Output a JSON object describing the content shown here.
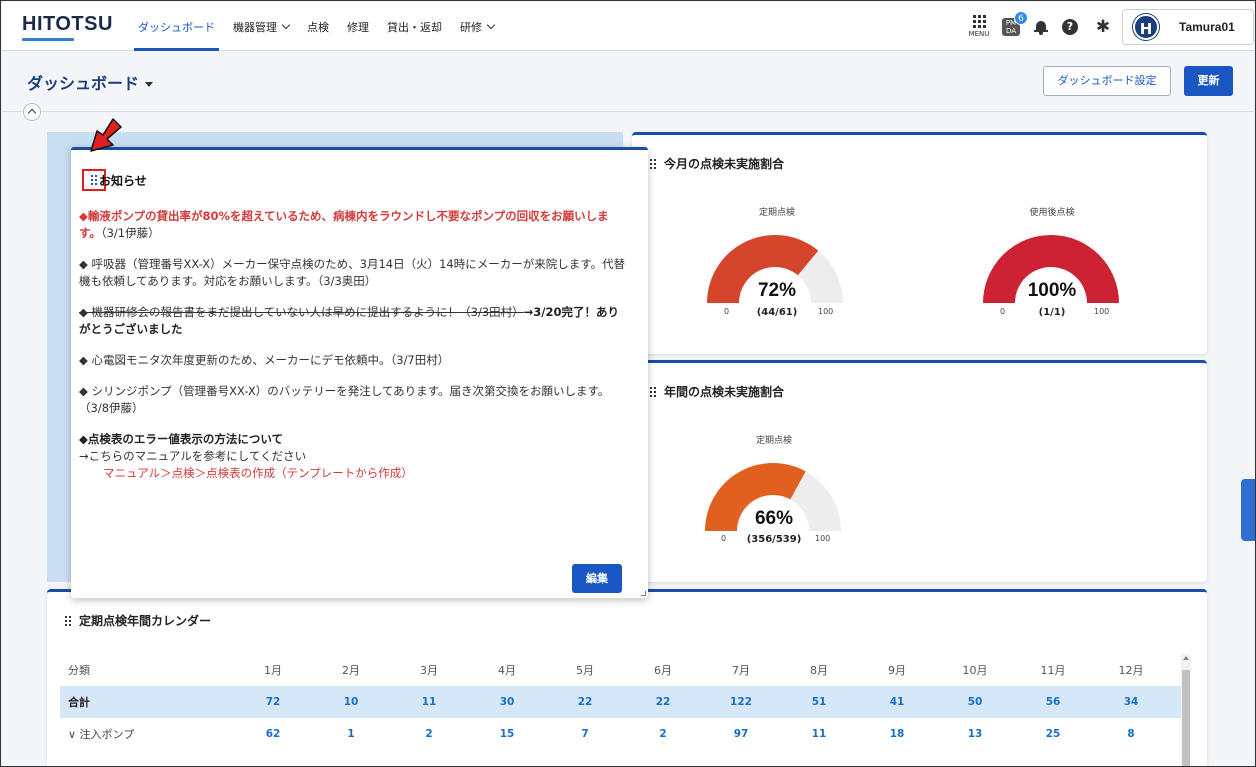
{
  "header": {
    "logo": "HITOTSU",
    "nav": [
      {
        "label": "ダッシュボード",
        "active": true,
        "dropdown": false
      },
      {
        "label": "機器管理",
        "active": false,
        "dropdown": true
      },
      {
        "label": "点検",
        "active": false,
        "dropdown": false
      },
      {
        "label": "修理",
        "active": false,
        "dropdown": false
      },
      {
        "label": "貸出・返却",
        "active": false,
        "dropdown": false
      },
      {
        "label": "研修",
        "active": false,
        "dropdown": true
      }
    ],
    "menu_label": "MENU",
    "pmda_label": "PM DA",
    "notification_count": "6",
    "help_icon": "?",
    "avatar_initial": "H",
    "user_name": "Tamura01"
  },
  "page": {
    "title": "ダッシュボード",
    "settings_button": "ダッシュボード設定",
    "refresh_button": "更新"
  },
  "notice": {
    "title": "お知らせ",
    "items": [
      {
        "main": "◆輸液ポンプの貸出率が80%を超えているため、病棟内をラウンドし不要なポンプの回収をお願いします。",
        "suffix": "（3/1伊藤）"
      },
      {
        "main": "◆ 呼吸器（管理番号XX-X）メーカー保守点検のため、3月14日（火）14時にメーカーが来院します。代替機も依頼してあります。対応をお願いします。（3/3奥田）"
      },
      {
        "strike": "◆ 機器研修会の報告書をまだ提出していない人は早めに提出するように！（3/3田村）",
        "after": "→3/20完了！ありがとうございました"
      },
      {
        "main": "◆ 心電図モニタ次年度更新のため、メーカーにデモ依頼中。（3/7田村）"
      },
      {
        "main": "◆ シリンジポンプ（管理番号XX-X）のバッテリーを発注してあります。届き次第交換をお願いします。（3/8伊藤）"
      },
      {
        "heading": "◆点検表のエラー値表示の方法について",
        "line": "→こちらのマニュアルを参考にしてください",
        "link": "マニュアル＞点検＞点検表の作成（テンプレートから作成）"
      }
    ],
    "edit_button": "編集"
  },
  "monthly": {
    "title": "今月の点検未実施割合",
    "gauges": [
      {
        "label": "定期点検",
        "percent": "72%",
        "count": "(44/61)",
        "value": 72,
        "color": "#d5452c",
        "min": "0",
        "max": "100"
      },
      {
        "label": "使用後点検",
        "percent": "100%",
        "count": "(1/1)",
        "value": 100,
        "color": "#cc2233",
        "min": "0",
        "max": "100"
      }
    ]
  },
  "annual": {
    "title": "年間の点検未実施割合",
    "gauges": [
      {
        "label": "定期点検",
        "percent": "66%",
        "count": "(356/539)",
        "value": 66,
        "color": "#e2601f",
        "min": "0",
        "max": "100"
      }
    ]
  },
  "calendar": {
    "title": "定期点検年間カレンダー",
    "header": [
      "分類",
      "1月",
      "2月",
      "3月",
      "4月",
      "5月",
      "6月",
      "7月",
      "8月",
      "9月",
      "10月",
      "11月",
      "12月"
    ],
    "rows": [
      {
        "label": "合計",
        "values": [
          "72",
          "10",
          "11",
          "30",
          "22",
          "22",
          "122",
          "51",
          "41",
          "50",
          "56",
          "34"
        ]
      },
      {
        "label": "注入ポンプ",
        "values": [
          "62",
          "1",
          "2",
          "15",
          "7",
          "2",
          "97",
          "11",
          "18",
          "13",
          "25",
          "8"
        ]
      }
    ]
  }
}
